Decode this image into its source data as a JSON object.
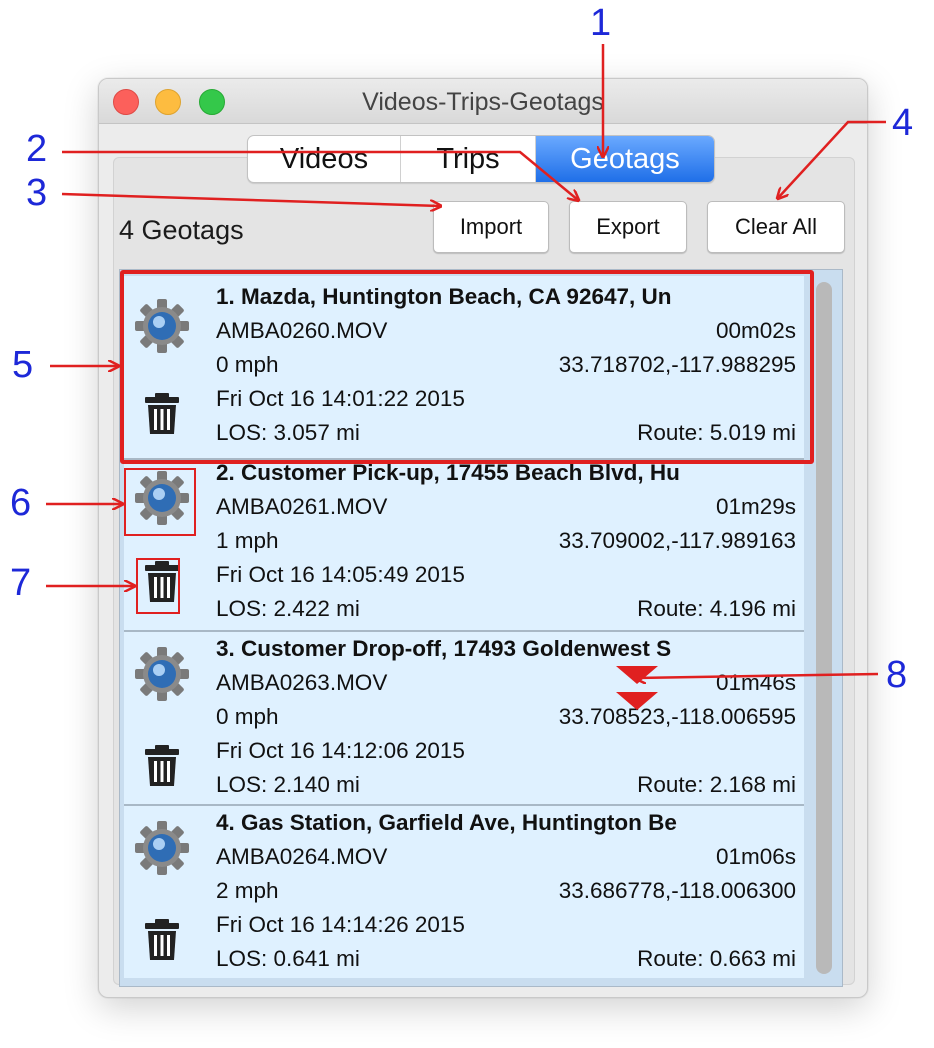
{
  "window": {
    "title": "Videos-Trips-Geotags"
  },
  "tabs": [
    {
      "label": "Videos",
      "selected": false
    },
    {
      "label": "Trips",
      "selected": false
    },
    {
      "label": "Geotags",
      "selected": true
    }
  ],
  "toolbar": {
    "count_label": "4 Geotags",
    "import_label": "Import",
    "export_label": "Export",
    "clear_all_label": "Clear All"
  },
  "geotags": [
    {
      "title": "1. Mazda, Huntington Beach, CA 92647, Un",
      "file": "AMBA0260.MOV",
      "duration": "00m02s",
      "speed": "0  mph",
      "coords": "33.718702,-117.988295",
      "datetime": "Fri Oct 16 14:01:22 2015",
      "los": "LOS: 3.057 mi",
      "route": "Route: 5.019 mi"
    },
    {
      "title": "2. Customer Pick-up, 17455 Beach Blvd, Hu",
      "file": "AMBA0261.MOV",
      "duration": "01m29s",
      "speed": "1  mph",
      "coords": "33.709002,-117.989163",
      "datetime": "Fri Oct 16 14:05:49 2015",
      "los": "LOS: 2.422 mi",
      "route": "Route: 4.196 mi"
    },
    {
      "title": "3. Customer Drop-off, 17493 Goldenwest S",
      "file": "AMBA0263.MOV",
      "duration": "01m46s",
      "speed": "0  mph",
      "coords": "33.708523,-118.006595",
      "datetime": "Fri Oct 16 14:12:06 2015",
      "los": "LOS: 2.140 mi",
      "route": "Route: 2.168 mi"
    },
    {
      "title": "4. Gas Station, Garfield Ave, Huntington Be",
      "file": "AMBA0264.MOV",
      "duration": "01m06s",
      "speed": "2  mph",
      "coords": "33.686778,-118.006300",
      "datetime": "Fri Oct 16 14:14:26 2015",
      "los": "LOS: 0.641 mi",
      "route": "Route: 0.663 mi"
    }
  ],
  "callouts": [
    "1",
    "2",
    "3",
    "4",
    "5",
    "6",
    "7",
    "8"
  ],
  "icons": {
    "row_settings": "gear-icon",
    "row_delete": "trash-icon",
    "reorder": "reorder-arrows-icon"
  },
  "colors": {
    "callout_number": "#1d28d8",
    "callout_arrow": "#e02020",
    "selected_tab": "#2f7cf0",
    "row_background": "#dff1ff"
  }
}
